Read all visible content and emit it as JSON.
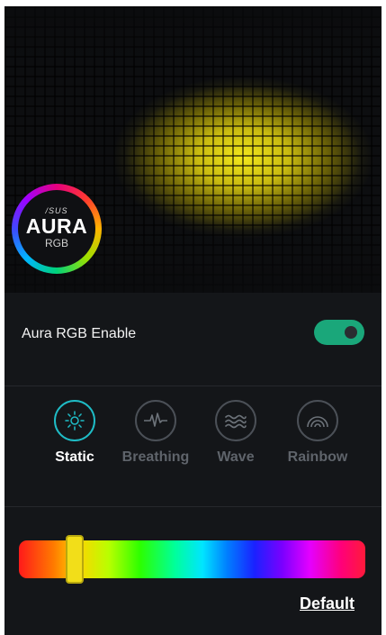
{
  "logo": {
    "brand": "/SUS",
    "title": "AURA",
    "subtitle": "RGB"
  },
  "enable": {
    "label": "Aura RGB Enable",
    "state": "on",
    "accent_color": "#1aa77a"
  },
  "modes": [
    {
      "label": "Static",
      "icon": "sun-icon",
      "active": true
    },
    {
      "label": "Breathing",
      "icon": "heartbeat-icon",
      "active": false
    },
    {
      "label": "Wave",
      "icon": "wave-icon",
      "active": false
    },
    {
      "label": "Rainbow",
      "icon": "rainbow-icon",
      "active": false
    }
  ],
  "color": {
    "selected_color": "#f2de19",
    "slider_fraction": 0.16
  },
  "actions": {
    "default_label": "Default"
  }
}
